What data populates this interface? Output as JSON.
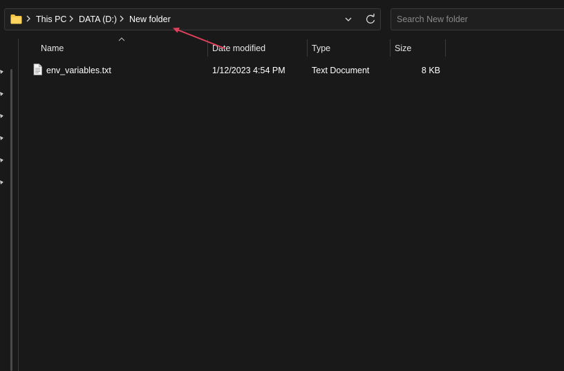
{
  "address_bar": {
    "breadcrumbs": [
      {
        "label": "This PC"
      },
      {
        "label": "DATA (D:)"
      },
      {
        "label": "New folder"
      }
    ],
    "icon": "folder-icon",
    "dropdown_icon": "chevron-down-icon",
    "refresh_icon": "refresh-icon"
  },
  "search": {
    "placeholder": "Search New folder",
    "value": ""
  },
  "columns": {
    "name": "Name",
    "date_modified": "Date modified",
    "type": "Type",
    "size": "Size",
    "sorted_by": "Name",
    "sort_icon": "sort-ascending-icon"
  },
  "files": [
    {
      "name": "env_variables.txt",
      "date_modified": "1/12/2023 4:54 PM",
      "type": "Text Document",
      "size": "8 KB",
      "icon": "text-file-icon"
    }
  ],
  "navigation_pane": {
    "pinned_icon": "pin-icon",
    "pinned_count": 6
  },
  "annotation": {
    "icon": "arrow-icon",
    "color": "#e0405c"
  },
  "colors": {
    "background": "#191919",
    "folder_yellow": "#f5c342",
    "accent_arrow": "#e0405c"
  }
}
